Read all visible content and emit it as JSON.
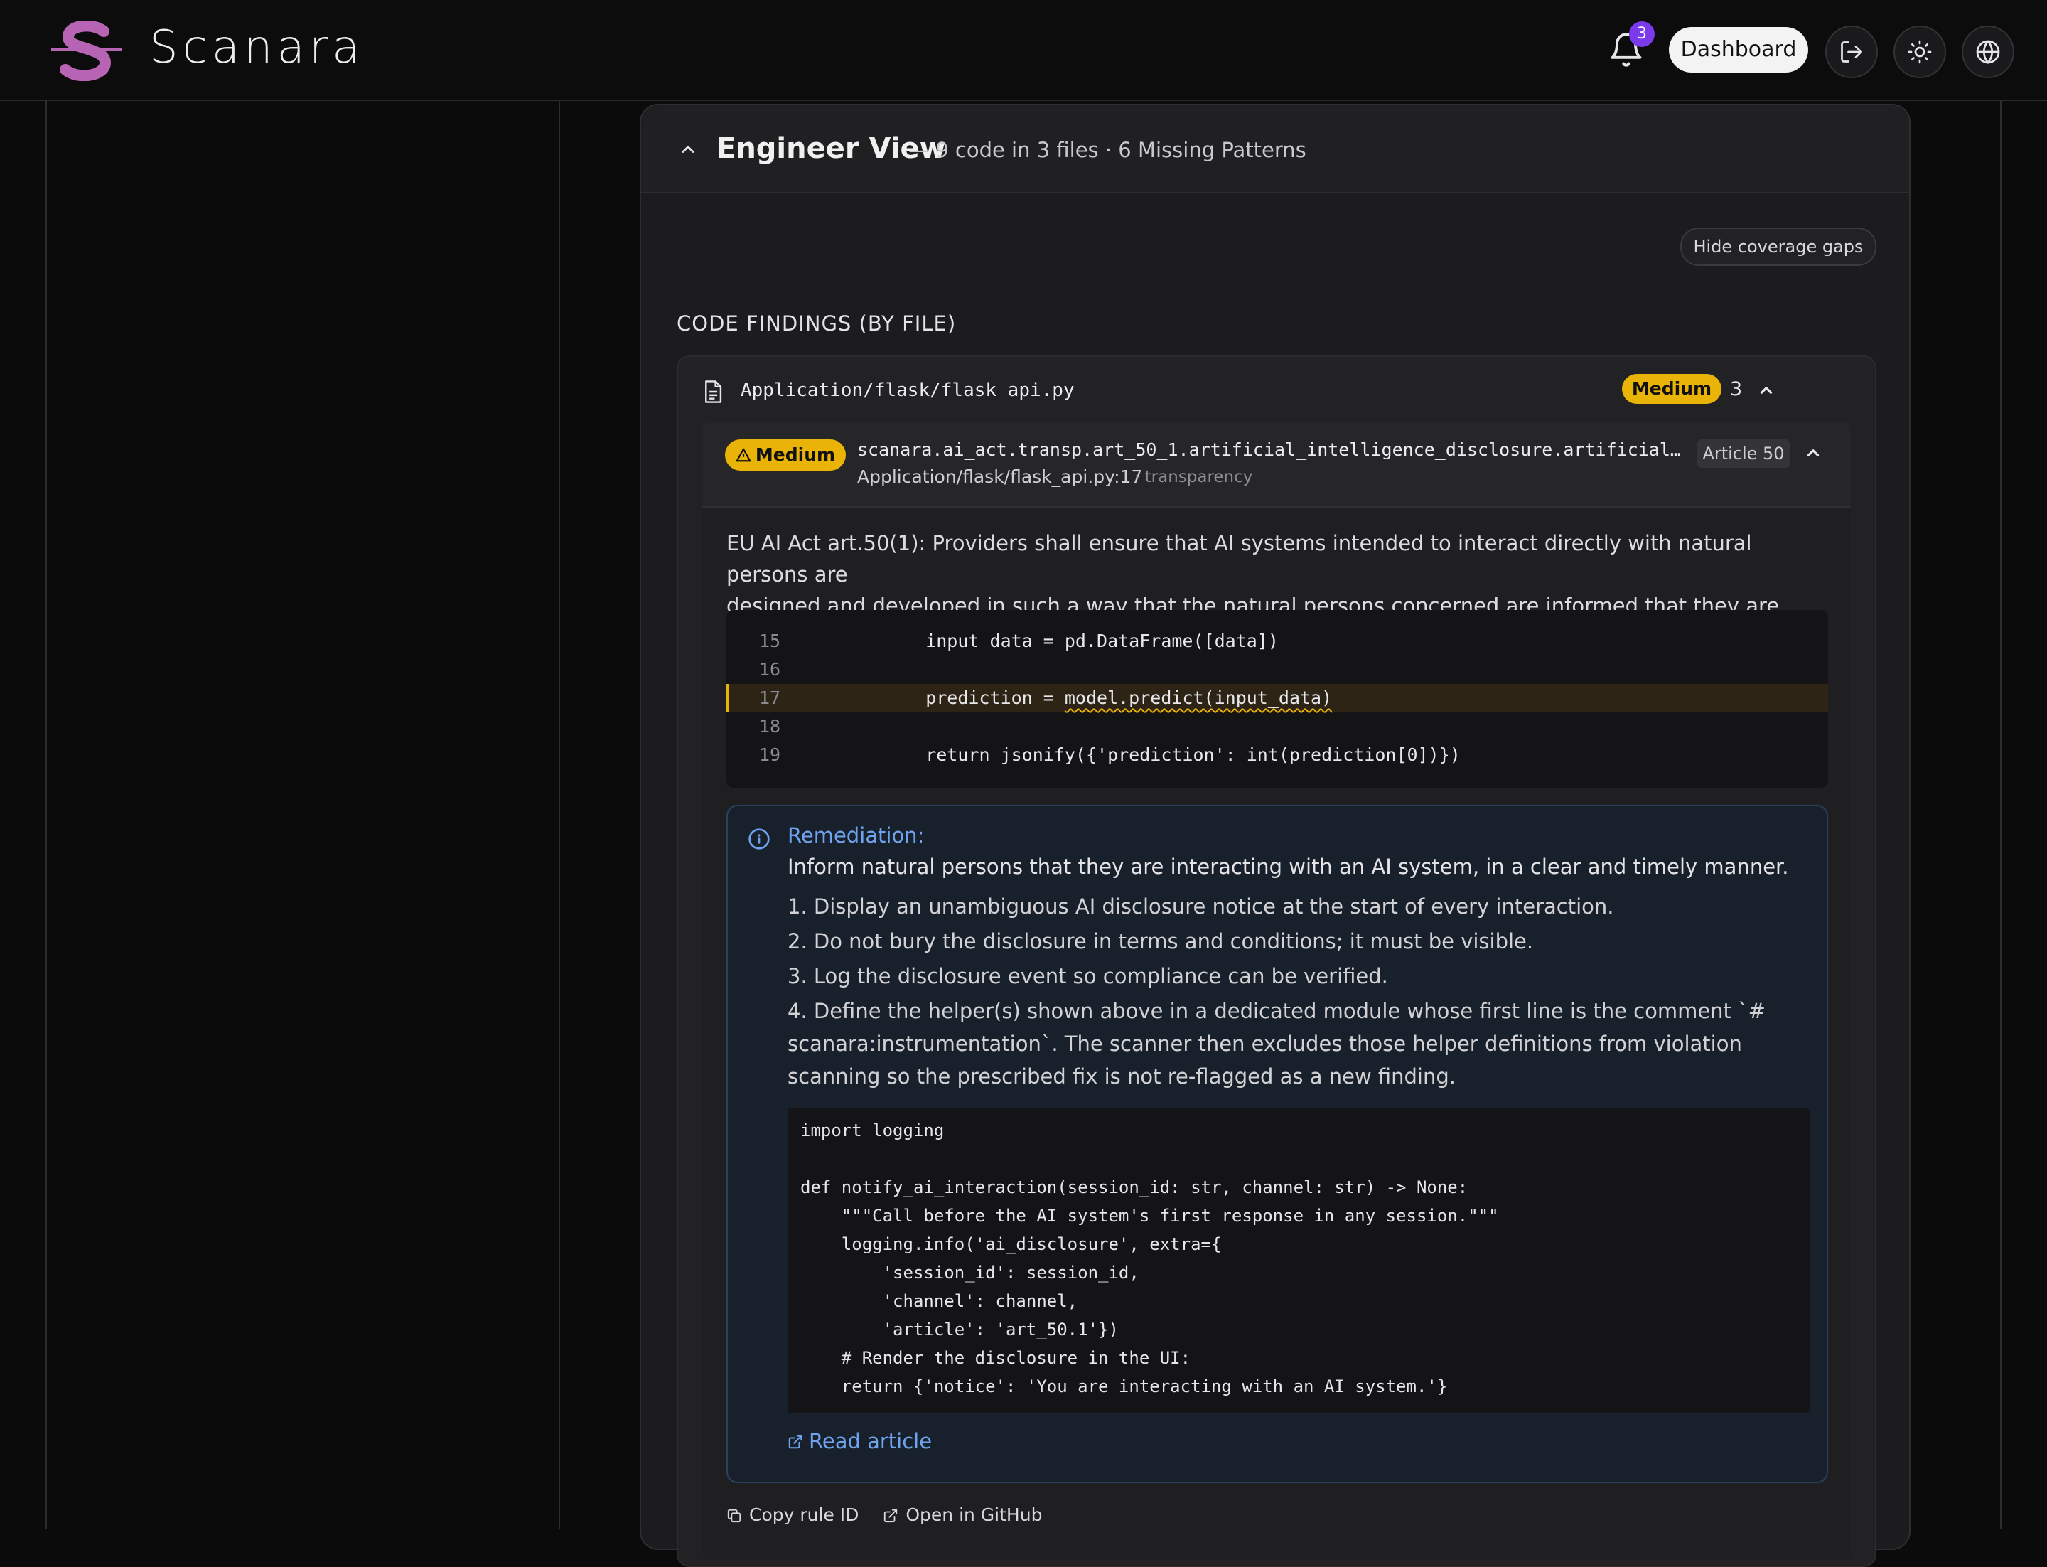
{
  "app": {
    "brand": "Scanara",
    "notifications_count": "3"
  },
  "header": {
    "dashboard_label": "Dashboard",
    "icons": [
      "bell-icon",
      "logout-icon",
      "sun-icon",
      "globe-icon"
    ]
  },
  "engineer_view": {
    "title": "Engineer View",
    "subtitle": "— 9 code in 3 files · 6 Missing Patterns",
    "hide_gaps_label": "Hide coverage gaps",
    "section_title": "CODE FINDINGS (BY FILE)"
  },
  "file": {
    "path": "Application/flask/flask_api.py",
    "severity": "Medium",
    "count": "3"
  },
  "finding": {
    "severity": "Medium",
    "rule_id": "scanara.ai_act.transp.art_50_1.artificial_intelligence_disclosure.artificial_in…",
    "location": "Application/flask/flask_api.py:17",
    "category": "· transparency",
    "article": "Article 50",
    "description_line1": "EU AI Act art.50(1): Providers shall ensure that AI systems intended to interact directly with natural persons are",
    "description_line2": "designed and developed in such a way that the natural persons concerned are informed that they are interac",
    "code_lines": [
      {
        "n": "15",
        "code": "    input_data = pd.DataFrame([data])"
      },
      {
        "n": "16",
        "code": ""
      },
      {
        "n": "17",
        "code_pre": "    prediction = ",
        "code_flag": "model.predict(input_data)"
      },
      {
        "n": "18",
        "code": ""
      },
      {
        "n": "19",
        "code": "    return jsonify({'prediction': int(prediction[0])})"
      }
    ]
  },
  "remediation": {
    "title": "Remediation:",
    "summary": "Inform natural persons that they are interacting with an AI system, in a clear and timely manner.",
    "steps": [
      "1. Display an unambiguous AI disclosure notice at the start of every interaction.",
      "2. Do not bury the disclosure in terms and conditions; it must be visible.",
      "3. Log the disclosure event so compliance can be verified.",
      "4. Define the helper(s) shown above in a dedicated module whose first line is the comment `# scanara:instrumentation`. The scanner then excludes those helper definitions from violation scanning so the prescribed fix is not re-flagged as a new finding."
    ],
    "code": "import logging\n\ndef notify_ai_interaction(session_id: str, channel: str) -> None:\n    \"\"\"Call before the AI system's first response in any session.\"\"\"\n    logging.info('ai_disclosure', extra={\n        'session_id': session_id,\n        'channel': channel,\n        'article': 'art_50.1'})\n    # Render the disclosure in the UI:\n    return {'notice': 'You are interacting with an AI system.'}",
    "read_article": "Read article"
  },
  "actions": {
    "copy_rule": "Copy rule ID",
    "open_github": "Open in GitHub"
  },
  "colors": {
    "accent_medium": "#eab308",
    "brand_purple": "#b864b4",
    "link_blue": "#6fa3ee",
    "badge_purple": "#7c3aed"
  }
}
